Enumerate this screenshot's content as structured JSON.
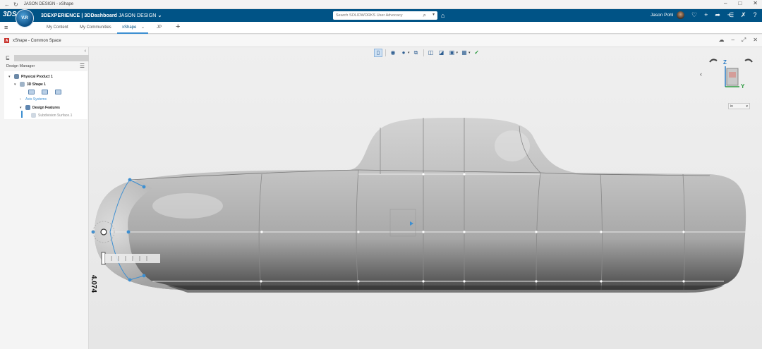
{
  "browser": {
    "window_title": "JASON DESIGN - xShape",
    "back_icon": "arrow-left-icon",
    "refresh_icon": "refresh-icon",
    "minimize_glyph": "–",
    "maximize_glyph": "□",
    "close_glyph": "✕"
  },
  "header": {
    "logo": "3DS",
    "compass_label": "V.R",
    "brand_bold": "3DEXPERIENCE | 3DDashboard",
    "brand_light": "JASON DESIGN",
    "search_placeholder": "Search SOLIDWORKS User Advocacy",
    "user_name": "Jason Pohl",
    "accent_color": "#005386"
  },
  "tabs": {
    "items": [
      "My Content",
      "My Communities",
      "xShape",
      "JP"
    ],
    "active": "xShape",
    "add_label": "+"
  },
  "app": {
    "title": "xShape - Common Space",
    "icon_letter": "A"
  },
  "tree": {
    "panel_title": "Design Manager",
    "nodes": {
      "physical_product": "Physical Product 1",
      "shape": "3D Shape 1",
      "axis_systems": "Axis Systems",
      "design_features": "Design Features",
      "subdivision": "Subdivision Surface.1"
    }
  },
  "viewport": {
    "dimension_value": "4.074",
    "scale_value": "in",
    "axes": {
      "z": "Z",
      "y": "Y"
    }
  }
}
